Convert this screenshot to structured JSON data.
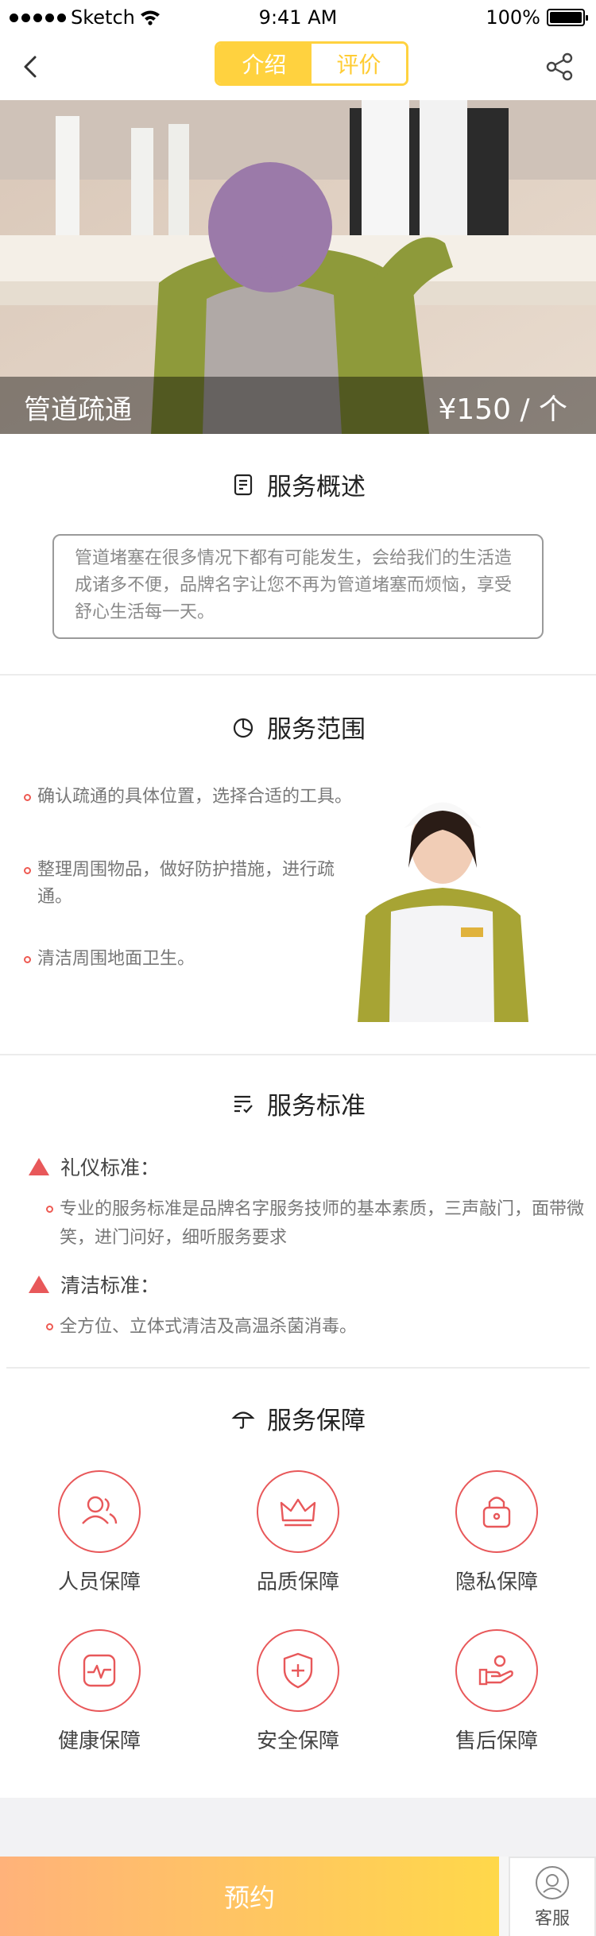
{
  "status_bar": {
    "carrier": "Sketch",
    "time": "9:41 AM",
    "battery": "100%",
    "battery_level": 1.0
  },
  "nav": {
    "tabs": [
      {
        "label": "介绍",
        "active": true
      },
      {
        "label": "评价",
        "active": false
      }
    ],
    "icons": {
      "back": "chevron-left-icon",
      "share": "share-icon"
    }
  },
  "hero": {
    "title": "管道疏通",
    "price": "¥150 / 个"
  },
  "overview": {
    "title": "服务概述",
    "text": "管道堵塞在很多情况下都有可能发生，会给我们的生活造成诸多不便，品牌名字让您不再为管道堵塞而烦恼，享受舒心生活每一天。"
  },
  "scope": {
    "title": "服务范围",
    "items": [
      "确认疏通的具体位置，选择合适的工具。",
      "整理周围物品，做好防护措施，进行疏通。",
      "清洁周围地面卫生。"
    ]
  },
  "standard": {
    "title": "服务标准",
    "groups": [
      {
        "heading": "礼仪标准：",
        "text": "专业的服务标准是品牌名字服务技师的基本素质，三声敲门，面带微笑，进门问好，细听服务要求"
      },
      {
        "heading": "清洁标准：",
        "text": "全方位、立体式清洁及高温杀菌消毒。"
      }
    ]
  },
  "guarantee": {
    "title": "服务保障",
    "items": [
      {
        "label": "人员保障",
        "icon": "users-icon"
      },
      {
        "label": "品质保障",
        "icon": "crown-icon"
      },
      {
        "label": "隐私保障",
        "icon": "lock-icon"
      },
      {
        "label": "健康保障",
        "icon": "heartbeat-icon"
      },
      {
        "label": "安全保障",
        "icon": "shield-plus-icon"
      },
      {
        "label": "售后保障",
        "icon": "hand-service-icon"
      }
    ]
  },
  "bottom": {
    "book_label": "预约",
    "service_label": "客服"
  },
  "colors": {
    "accent_yellow": "#ffd23f",
    "accent_red": "#e8585a",
    "book_gradient_start": "#ffb27a",
    "book_gradient_end": "#ffd84a"
  }
}
